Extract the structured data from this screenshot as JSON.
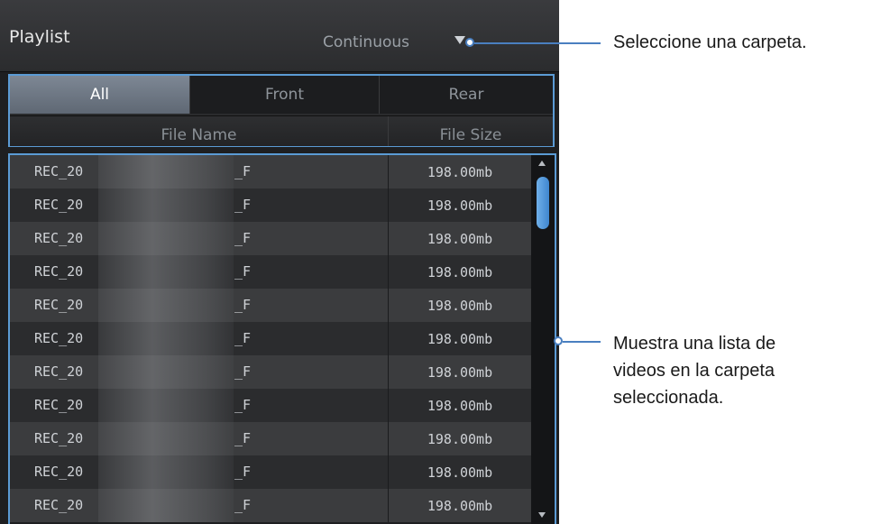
{
  "header": {
    "title": "Playlist",
    "mode": "Continuous"
  },
  "tabs": [
    {
      "label": "All",
      "active": true
    },
    {
      "label": "Front",
      "active": false
    },
    {
      "label": "Rear",
      "active": false
    }
  ],
  "columns": {
    "name": "File Name",
    "size": "File Size"
  },
  "rows": [
    {
      "prefix": "REC_20",
      "suffix": "_F",
      "size": "198.00mb"
    },
    {
      "prefix": "REC_20",
      "suffix": "_F",
      "size": "198.00mb"
    },
    {
      "prefix": "REC_20",
      "suffix": "_F",
      "size": "198.00mb"
    },
    {
      "prefix": "REC_20",
      "suffix": "_F",
      "size": "198.00mb"
    },
    {
      "prefix": "REC_20",
      "suffix": "_F",
      "size": "198.00mb"
    },
    {
      "prefix": "REC_20",
      "suffix": "_F",
      "size": "198.00mb"
    },
    {
      "prefix": "REC_20",
      "suffix": "_F",
      "size": "198.00mb"
    },
    {
      "prefix": "REC_20",
      "suffix": "_F",
      "size": "198.00mb"
    },
    {
      "prefix": "REC_20",
      "suffix": "_F",
      "size": "198.00mb"
    },
    {
      "prefix": "REC_20",
      "suffix": "_F",
      "size": "198.00mb"
    },
    {
      "prefix": "REC_20",
      "suffix": "_F",
      "size": "198.00mb"
    }
  ],
  "annotations": {
    "folder": "Seleccione una carpeta.",
    "list_line1": "Muestra una lista de",
    "list_line2": "videos en la carpeta",
    "list_line3": "seleccionada."
  },
  "colors": {
    "accent": "#5b9bd5",
    "panel": "#1e1f21",
    "active_tab": "#6e7885"
  }
}
